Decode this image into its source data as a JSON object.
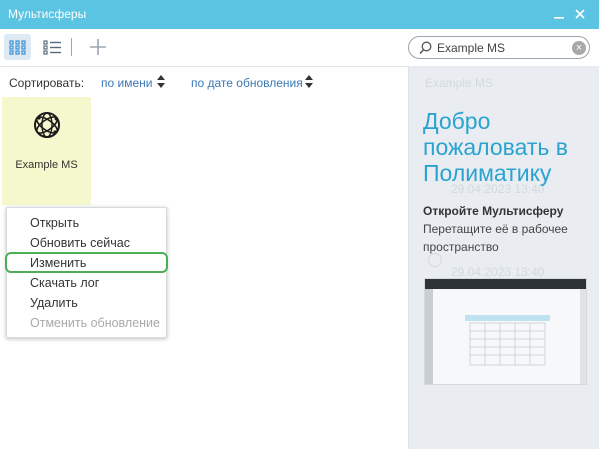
{
  "window": {
    "title": "Мультисферы",
    "minimize_icon": "minimize-icon",
    "close_icon": "close-icon"
  },
  "toolbar": {
    "grid_view_icon": "grid-view-icon",
    "list_view_icon": "list-view-icon",
    "add_icon": "plus-icon",
    "active_view": "grid"
  },
  "search": {
    "value": "Example MS",
    "icon": "search-icon",
    "clear_icon": "clear-icon"
  },
  "sort": {
    "label": "Сортировать:",
    "by_name": "по имени",
    "by_update": "по дате обновления"
  },
  "tiles": [
    {
      "name": "Example MS",
      "icon": "multisphere-globe-icon",
      "color": "#f5f7cc"
    }
  ],
  "context_menu": {
    "items": [
      {
        "label": "Открыть",
        "disabled": false
      },
      {
        "label": "Обновить сейчас",
        "disabled": false
      },
      {
        "label": "Изменить",
        "disabled": false
      },
      {
        "label": "Скачать лог",
        "disabled": false
      },
      {
        "label": "Удалить",
        "disabled": false
      },
      {
        "label": "Отменить обновление",
        "disabled": true
      }
    ],
    "highlighted": "Изменить",
    "highlight_color": "#4cae57"
  },
  "right_panel": {
    "welcome": "Добро пожаловать в Полиматику",
    "open_title": "Откройте Мультисферу",
    "open_desc": "Перетащите её в рабочее пространство",
    "accent_color": "#2aa2d2",
    "ghost": {
      "name": "Example MS",
      "date1": "29.04.2023 13:40",
      "date2": "29.04.2023 13:40"
    }
  },
  "colors": {
    "titlebar": "#5bc4e2",
    "panel_bg": "#e9edf1",
    "link": "#3a78b5"
  }
}
